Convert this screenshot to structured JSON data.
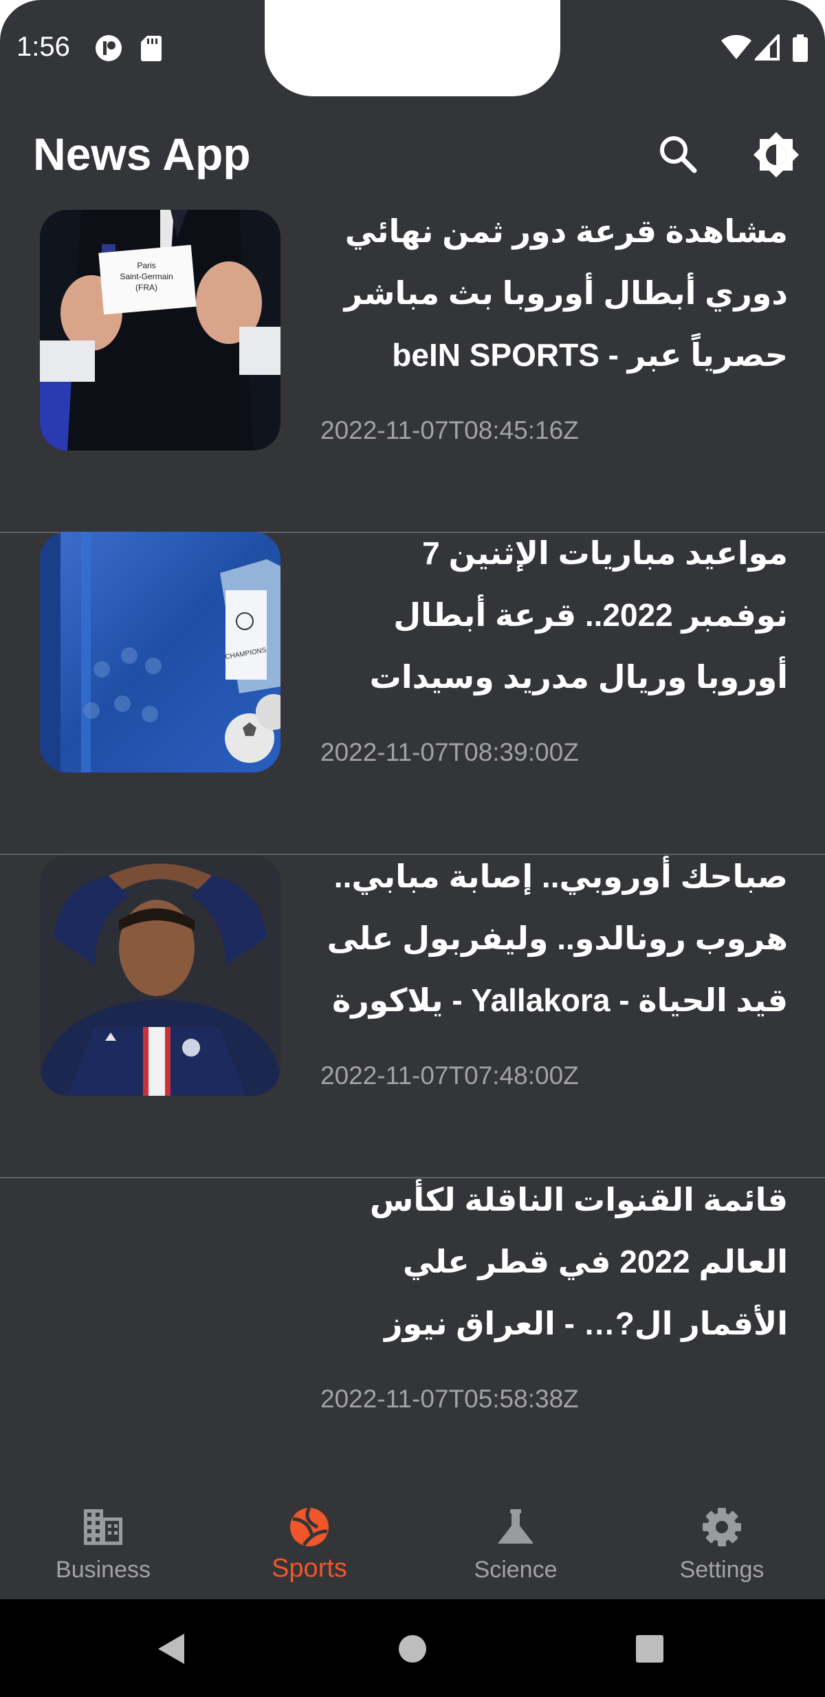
{
  "status_bar": {
    "time": "1:56"
  },
  "app_bar": {
    "title": "News App"
  },
  "articles": [
    {
      "headline": "مشاهدة قرعة دور ثمن نهائي دوري أبطال أوروبا بث مباشر حصرياً عبر beIN SPORTS - beIN …",
      "published": "2022-11-07T08:45:16Z",
      "image_caption": "Paris Saint-Germain (FRA)"
    },
    {
      "headline": "مواعيد مباريات الإثنين 7 نوفمبر 2022.. قرعة أبطال أوروبا وريال مدريد وسيدات الطائرة…",
      "published": "2022-11-07T08:39:00Z"
    },
    {
      "headline": "صباحك أوروبي.. إصابة مبابي.. هروب رونالدو.. وليفربول على قيد الحياة - Yallakora - يلاكورة",
      "published": "2022-11-07T07:48:00Z"
    },
    {
      "headline": "قائمة القنوات الناقلة لكأس العالم 2022 في قطر علي الأقمار ال?… - العراق نيوز",
      "published": "2022-11-07T05:58:38Z"
    }
  ],
  "bottom_nav": [
    {
      "label": "Business",
      "icon": "business-icon",
      "active": false
    },
    {
      "label": "Sports",
      "icon": "sports-icon",
      "active": true
    },
    {
      "label": "Science",
      "icon": "science-icon",
      "active": false
    },
    {
      "label": "Settings",
      "icon": "settings-icon",
      "active": false
    }
  ],
  "colors": {
    "background": "#333538",
    "accent": "#f0562a",
    "muted_text": "#a3a3a6",
    "divider": "#5e6064"
  }
}
